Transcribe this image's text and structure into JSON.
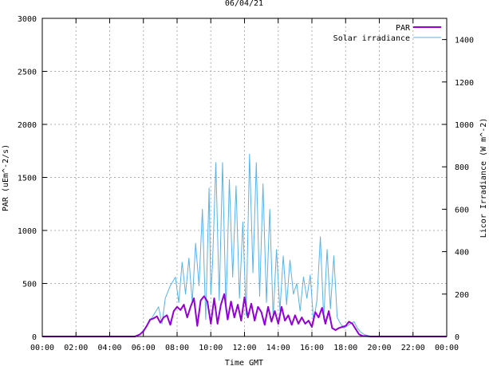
{
  "chart_data": {
    "type": "line",
    "title": "06/04/21",
    "xlabel": "Time GMT",
    "ylabel": "PAR (uEm^-2/s)",
    "y2label": "Licor Irradiance (W m^-2)",
    "xlim": [
      0,
      24
    ],
    "ylim": [
      0,
      3000
    ],
    "y2lim": [
      0,
      1500
    ],
    "x_ticks": [
      0,
      2,
      4,
      6,
      8,
      10,
      12,
      14,
      16,
      18,
      20,
      22,
      24
    ],
    "x_tick_labels": [
      "00:00",
      "02:00",
      "04:00",
      "06:00",
      "08:00",
      "10:00",
      "12:00",
      "14:00",
      "16:00",
      "18:00",
      "20:00",
      "22:00",
      "00:00"
    ],
    "y_ticks": [
      0,
      500,
      1000,
      1500,
      2000,
      2500,
      3000
    ],
    "y2_ticks": [
      0,
      200,
      400,
      600,
      800,
      1000,
      1200,
      1400
    ],
    "grid": true,
    "legend_position": "top-right",
    "series": [
      {
        "name": "PAR",
        "axis": "y",
        "color": "#9400d3",
        "x": [
          0,
          5.5,
          5.8,
          6.0,
          6.2,
          6.4,
          6.6,
          6.8,
          7.0,
          7.2,
          7.4,
          7.6,
          7.8,
          8.0,
          8.2,
          8.4,
          8.6,
          8.8,
          9.0,
          9.2,
          9.4,
          9.6,
          9.8,
          10.0,
          10.2,
          10.4,
          10.6,
          10.8,
          11.0,
          11.2,
          11.4,
          11.6,
          11.8,
          12.0,
          12.2,
          12.4,
          12.6,
          12.8,
          13.0,
          13.2,
          13.4,
          13.6,
          13.8,
          14.0,
          14.2,
          14.4,
          14.6,
          14.8,
          15.0,
          15.2,
          15.4,
          15.6,
          15.8,
          16.0,
          16.2,
          16.4,
          16.6,
          16.8,
          17.0,
          17.2,
          17.4,
          17.6,
          17.8,
          18.0,
          18.2,
          18.4,
          18.6,
          18.8,
          19.0,
          19.5,
          24
        ],
        "values": [
          0,
          0,
          20,
          50,
          100,
          160,
          170,
          190,
          130,
          180,
          200,
          110,
          240,
          280,
          250,
          300,
          180,
          280,
          360,
          100,
          340,
          380,
          330,
          120,
          360,
          120,
          300,
          400,
          160,
          330,
          180,
          300,
          150,
          370,
          180,
          310,
          150,
          280,
          230,
          110,
          280,
          140,
          240,
          120,
          280,
          150,
          200,
          110,
          200,
          120,
          180,
          120,
          150,
          90,
          230,
          180,
          270,
          120,
          240,
          80,
          60,
          80,
          90,
          100,
          140,
          120,
          70,
          20,
          5,
          0,
          0
        ]
      },
      {
        "name": "Solar irradiance",
        "axis": "y2",
        "color": "#56b4e9",
        "x": [
          0,
          5.5,
          5.8,
          6.0,
          6.3,
          6.6,
          6.9,
          7.1,
          7.3,
          7.6,
          7.9,
          8.1,
          8.3,
          8.5,
          8.7,
          8.9,
          9.1,
          9.3,
          9.5,
          9.7,
          9.9,
          10.0,
          10.1,
          10.3,
          10.5,
          10.7,
          10.9,
          11.1,
          11.3,
          11.5,
          11.7,
          11.9,
          12.1,
          12.3,
          12.5,
          12.7,
          12.9,
          13.1,
          13.3,
          13.5,
          13.7,
          13.9,
          14.1,
          14.3,
          14.5,
          14.7,
          14.9,
          15.1,
          15.3,
          15.5,
          15.7,
          15.9,
          16.1,
          16.3,
          16.5,
          16.7,
          16.9,
          17.1,
          17.3,
          17.5,
          17.7,
          17.9,
          18.1,
          18.3,
          18.5,
          18.7,
          18.9,
          19.1,
          19.5,
          24
        ],
        "values": [
          0,
          0,
          10,
          30,
          60,
          100,
          140,
          60,
          180,
          240,
          280,
          160,
          350,
          200,
          370,
          160,
          440,
          240,
          600,
          80,
          700,
          200,
          340,
          820,
          170,
          820,
          120,
          740,
          280,
          710,
          180,
          540,
          100,
          860,
          300,
          820,
          190,
          720,
          160,
          600,
          90,
          410,
          120,
          380,
          150,
          360,
          200,
          250,
          120,
          280,
          180,
          290,
          70,
          170,
          470,
          80,
          410,
          130,
          380,
          90,
          60,
          40,
          50,
          60,
          70,
          40,
          20,
          10,
          0,
          0
        ]
      }
    ]
  }
}
